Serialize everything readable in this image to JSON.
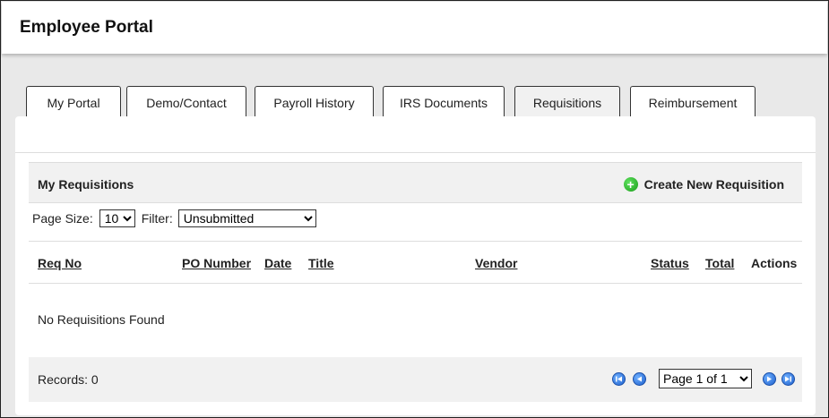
{
  "header": {
    "title": "Employee Portal"
  },
  "tabs": [
    {
      "label": "My Portal"
    },
    {
      "label": "Demo/Contact"
    },
    {
      "label": "Payroll History"
    },
    {
      "label": "IRS Documents"
    },
    {
      "label": "Requisitions",
      "active": true
    },
    {
      "label": "Reimbursement"
    }
  ],
  "requisitions": {
    "title": "My Requisitions",
    "create_label": "Create New Requisition",
    "create_icon": "plus-circle-icon",
    "page_size_label": "Page Size:",
    "page_size_value": "10",
    "filter_label": "Filter:",
    "filter_value": "Unsubmitted",
    "columns": [
      "Req No",
      "PO Number",
      "Date",
      "Title",
      "Vendor",
      "Status",
      "Total",
      "Actions"
    ],
    "empty_message": "No Requisitions Found",
    "records_text": "Records: 0",
    "page_value": "Page 1 of 1"
  },
  "colors": {
    "accent_green": "#22aa22",
    "nav_blue": "#1d5fcc",
    "panel_gray": "#f1f1f1"
  }
}
